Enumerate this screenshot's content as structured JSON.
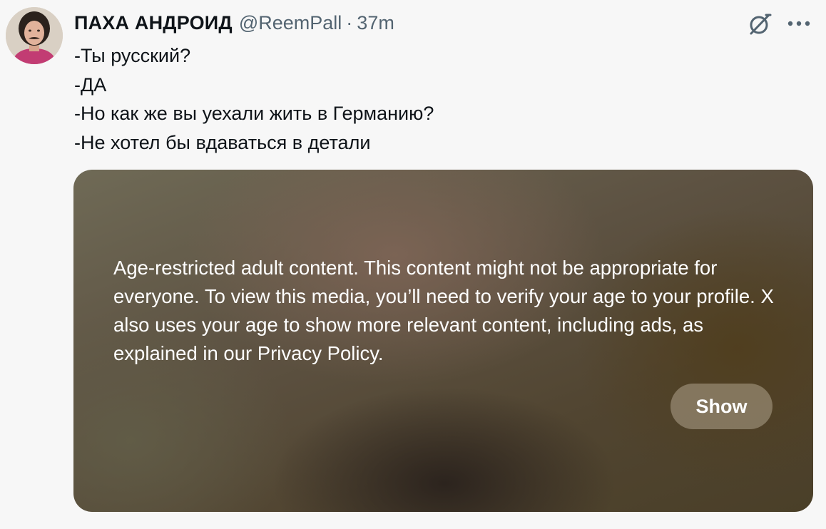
{
  "author": {
    "display_name": "ПАХА АНДРОИД",
    "handle": "@ReemPall",
    "separator": "·",
    "time": "37m",
    "avatar_icon": "avatar"
  },
  "actions": {
    "grok_icon": "grok-slash-circle-icon",
    "more_icon": "more-horizontal-icon"
  },
  "tweet": {
    "lines": [
      "-Ты русский?",
      "-ДА",
      "-Но как же вы уехали жить в Германию?",
      "-Не хотел бы вдаваться в детали"
    ]
  },
  "media": {
    "notice": "Age-restricted adult content. This content might not be appropriate for everyone. To view this media, you’ll need to verify your age to your profile. X also uses your age to show more relevant content, including ads, as explained in our Privacy Policy.",
    "show_label": "Show"
  },
  "colors": {
    "background": "#f7f7f7",
    "text_primary": "#0f1419",
    "text_secondary": "#536471",
    "overlay_text": "#ffffff"
  }
}
